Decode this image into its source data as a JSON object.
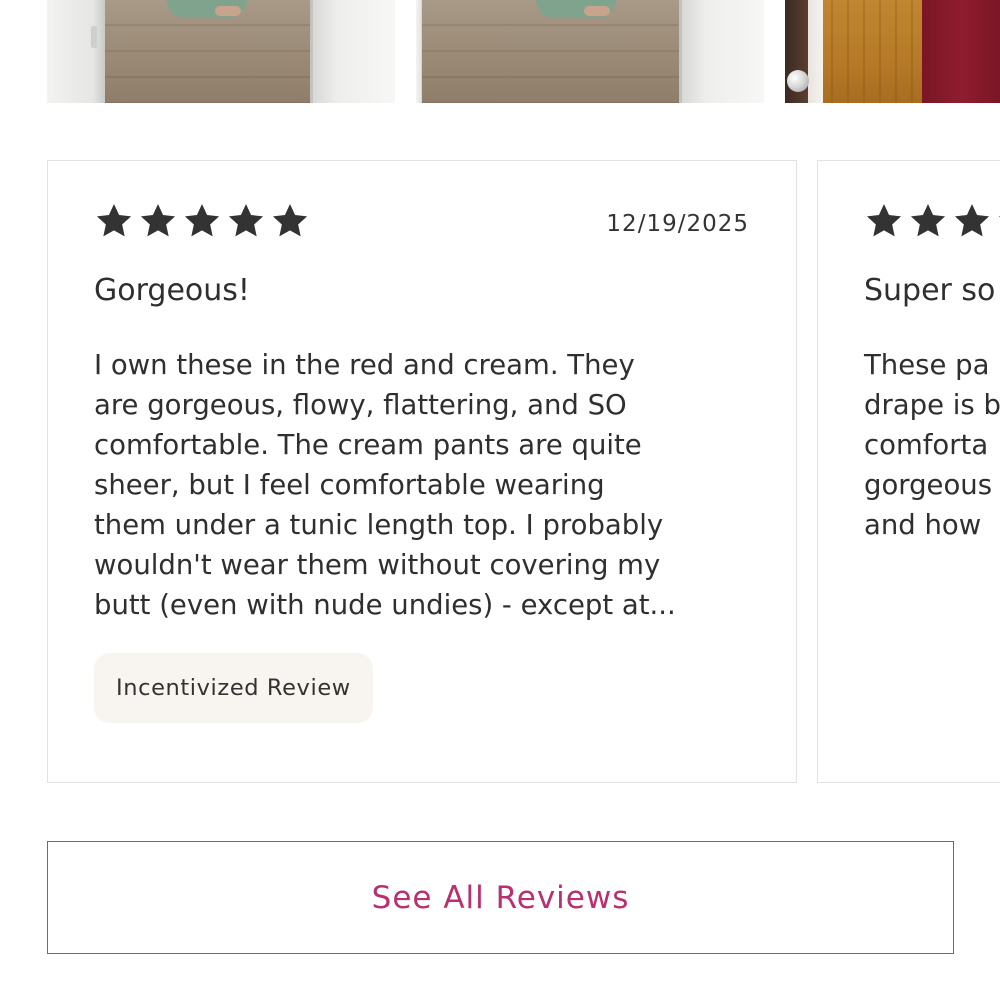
{
  "photos": [
    {
      "alt": "customer photo 1"
    },
    {
      "alt": "customer photo 2"
    },
    {
      "alt": "customer photo 3"
    }
  ],
  "reviews": [
    {
      "rating": 5,
      "date": "12/19/2025",
      "title": "Gorgeous!",
      "body": "I own these in the red and cream. They\nare gorgeous, flowy, flattering, and SO\ncomfortable. The cream pants are quite\nsheer, but I feel comfortable wearing\nthem under a tunic length top. I probably\nwouldn't wear them without covering my\nbutt (even with nude undies) - except at...",
      "badge": "Incentivized Review"
    },
    {
      "rating": 5,
      "title": "Super so",
      "body": "These pa\ndrape is b\ncomforta\ngorgeous\nand how"
    }
  ],
  "see_all_label": "See All Reviews",
  "colors": {
    "star": "#333333",
    "accent": "#b8306f",
    "badge_bg": "#f8f4ef",
    "card_border": "#e2e2e2"
  }
}
